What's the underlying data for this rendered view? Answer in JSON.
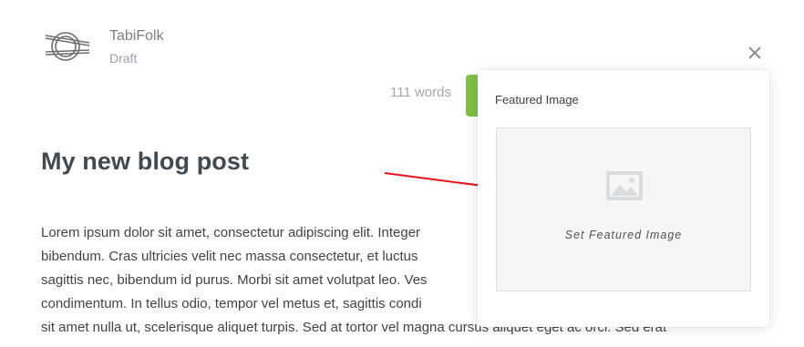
{
  "header": {
    "blog_name": "TabiFolk",
    "status": "Draft",
    "word_count": "111 words",
    "logo_icon": "tabifolk-logo-icon",
    "close_icon": "close-icon"
  },
  "post": {
    "title": "My new blog post",
    "body_lines": [
      "Lorem ipsum dolor sit amet, consectetur adipiscing elit. Integer",
      "bibendum. Cras ultricies velit nec massa consectetur, et luctus",
      "sagittis nec, bibendum id purus. Morbi sit amet volutpat leo. Ves",
      "condimentum. In tellus odio, tempor vel metus et, sagittis condi",
      "sit amet nulla ut, scelerisque aliquet turpis. Sed at tortor vel magna cursus aliquet eget ac orci. Sed erat"
    ]
  },
  "popover": {
    "title": "Featured Image",
    "button_label": "Set Featured Image",
    "icon": "image-placeholder-icon"
  },
  "colors": {
    "publish_green": "#7cc243",
    "annotation_arrow": "#e8121a"
  }
}
